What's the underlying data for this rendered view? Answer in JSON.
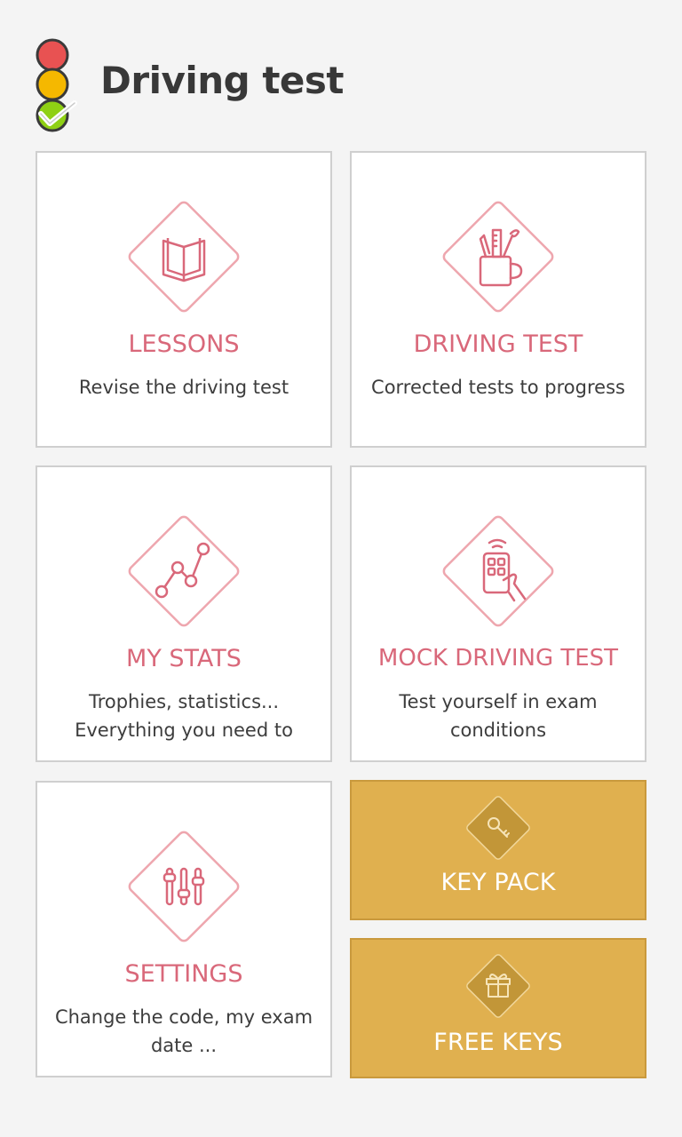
{
  "header": {
    "title": "Driving test",
    "logo_icon": "traffic-light-check-icon"
  },
  "tiles": {
    "lessons": {
      "title": "LESSONS",
      "subtitle": "Revise the driving test",
      "icon": "book-icon"
    },
    "driving_test": {
      "title": "DRIVING TEST",
      "subtitle": "Corrected tests to progress",
      "icon": "pencil-cup-icon"
    },
    "my_stats": {
      "title": "MY STATS",
      "subtitle_line1": "Trophies, statistics...",
      "subtitle_line2": "Everything you need to",
      "icon": "line-chart-icon"
    },
    "mock_test": {
      "title": "MOCK DRIVING TEST",
      "subtitle_line1": "Test yourself in exam",
      "subtitle_line2": "conditions",
      "icon": "remote-hand-icon"
    },
    "settings": {
      "title": "SETTINGS",
      "subtitle_line1": "Change the code, my exam",
      "subtitle_line2": "date ...",
      "icon": "sliders-icon"
    },
    "key_pack": {
      "title": "KEY PACK",
      "icon": "key-icon"
    },
    "free_keys": {
      "title": "FREE KEYS",
      "icon": "gift-icon"
    }
  },
  "colors": {
    "accent": "#d9687a",
    "gold": "#e0b04f",
    "background": "#f4f4f4",
    "text": "#3d3d3d"
  }
}
